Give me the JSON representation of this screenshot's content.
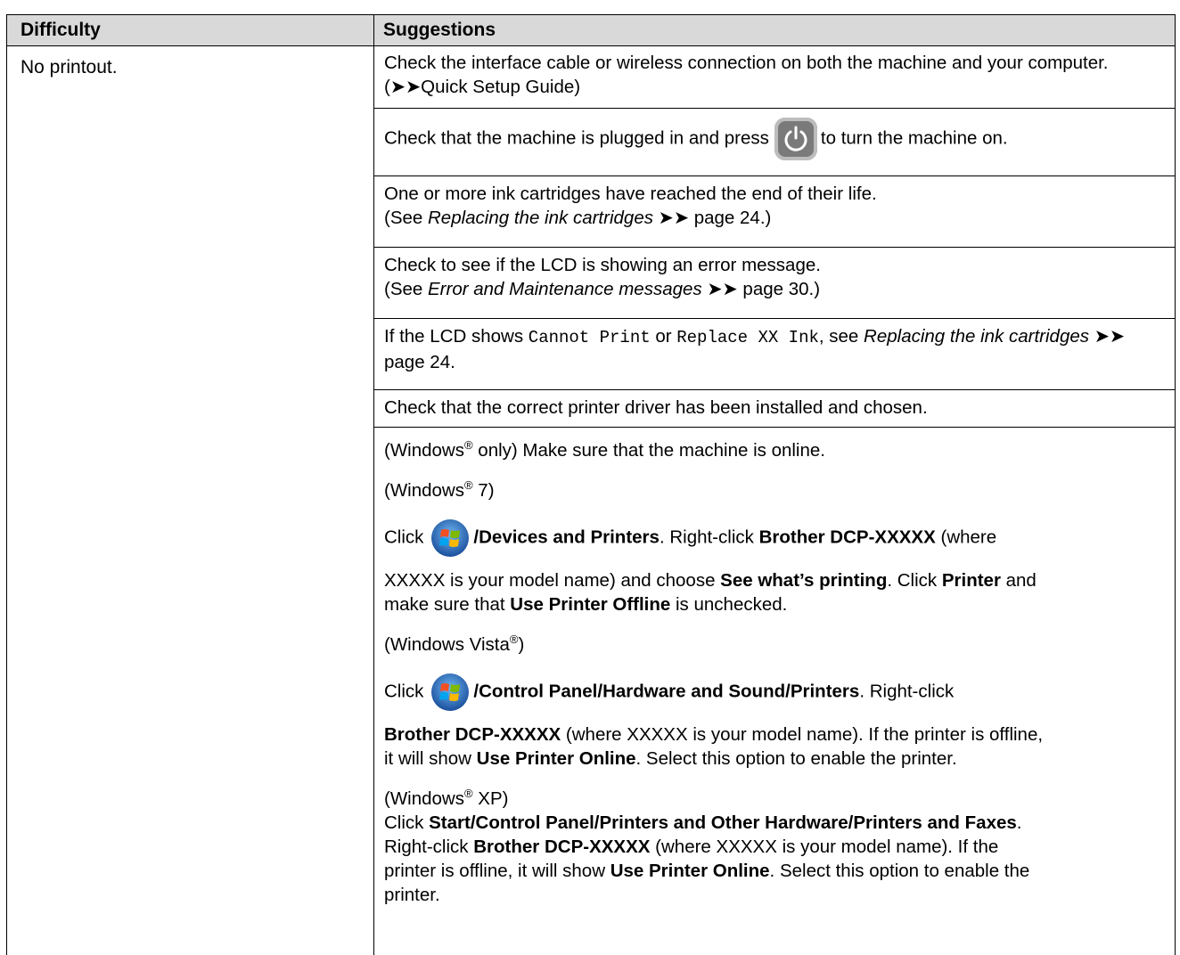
{
  "header": {
    "col1": "Difficulty",
    "col2": "Suggestions"
  },
  "difficulty": "No printout.",
  "rows": {
    "r1": "Check the interface cable or wireless connection on both the machine and your computer. (➤➤Quick Setup Guide)",
    "r2_pre": "Check that the machine is plugged in and press",
    "r2_post": "to turn the machine on.",
    "r3_line1": "One or more ink cartridges have reached the end of their life.",
    "r3_see": "(See ",
    "r3_italic": "Replacing the ink cartridges",
    "r3_tail": " ➤➤ page 24.)",
    "r4_line1": "Check to see if the LCD is showing an error message.",
    "r4_see": "(See ",
    "r4_italic": "Error and Maintenance messages",
    "r4_tail": " ➤➤ page 30.)",
    "r5_a": "If the LCD shows ",
    "r5_mono1": "Cannot Print",
    "r5_or": " or ",
    "r5_mono2": "Replace XX Ink",
    "r5_b": ", see ",
    "r5_italic": "Replacing the ink cartridges",
    "r5_tail": " ➤➤ page 24.",
    "r6": "Check that the correct printer driver has been installed and chosen."
  },
  "windows": {
    "w_intro_a": "(Windows",
    "reg": "®",
    "w_intro_b": " only) Make sure that the machine is online.",
    "w7_a": "(Windows",
    "w7_b": " 7)",
    "w7_click": "Click",
    "w7_path": "/Devices and Printers",
    "w7_t1": ". Right-click ",
    "w7_b1": "Brother DCP-XXXXX",
    "w7_t2": " (where",
    "w7_t3": "XXXXX is your model name) and choose ",
    "w7_b2": "See what’s printing",
    "w7_t4": ". Click ",
    "w7_b3": "Printer",
    "w7_t5": " and",
    "w7_t6": "make sure that ",
    "w7_b4": "Use Printer Offline",
    "w7_t7": " is unchecked.",
    "vista_a": "(Windows Vista",
    "vista_b": ")",
    "v_click": "Click",
    "v_path1": "/Control Panel",
    "v_slash1": "/",
    "v_path2": "Hardware and Sound",
    "v_slash2": "/",
    "v_path3": "Printers",
    "v_t1": ". Right-click",
    "v_b1": "Brother DCP-XXXXX",
    "v_t2": " (where XXXXX is your model name). If the printer is offline,",
    "v_t3": "it will show ",
    "v_b2": "Use Printer Online",
    "v_t4": ". Select this option to enable the printer.",
    "xp_a": "(Windows",
    "xp_b": " XP)",
    "xp_click": "Click ",
    "xp_p1": "Start",
    "xp_s1": "/",
    "xp_p2": "Control Panel",
    "xp_s2": "/",
    "xp_p3": "Printers and Other Hardware",
    "xp_s3": "/",
    "xp_p4": "Printers and Faxes",
    "xp_dot": ".",
    "xp_t1": "Right-click ",
    "xp_b1": "Brother DCP-XXXXX",
    "xp_t2": " (where XXXXX is your model name). If the",
    "xp_t3": "printer is offline, it will show ",
    "xp_b2": "Use Printer Online",
    "xp_t4": ". Select this option to enable the",
    "xp_t5": "printer."
  },
  "icons": {
    "power": "power-button-icon",
    "start": "windows-start-orb-icon"
  }
}
